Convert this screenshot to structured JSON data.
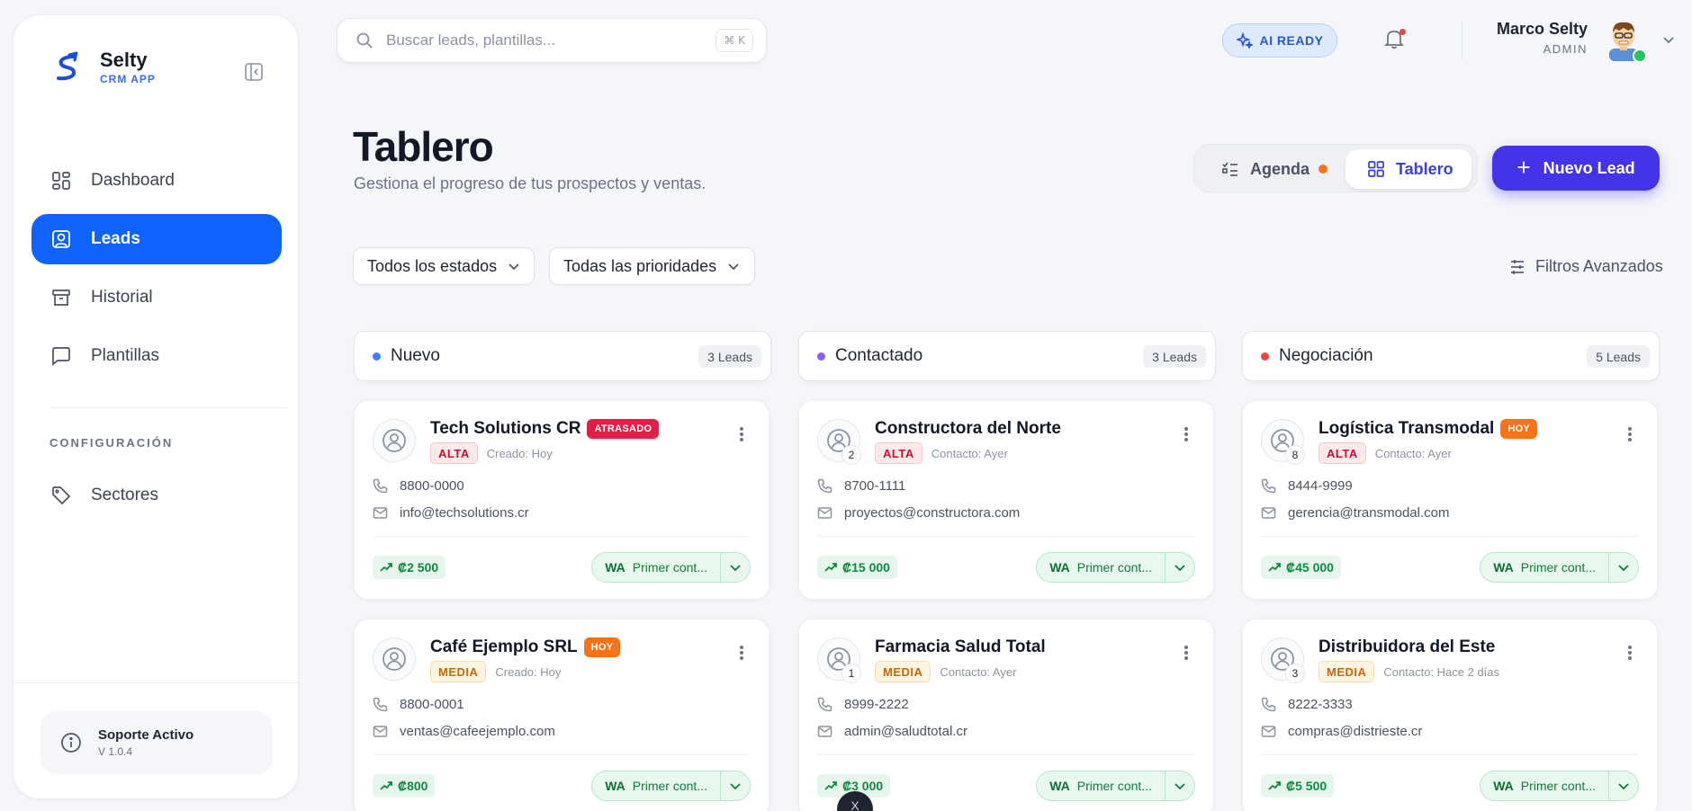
{
  "brand": {
    "name": "Selty",
    "sub": "CRM APP"
  },
  "nav": {
    "items": [
      {
        "label": "Dashboard",
        "icon": "grid-icon",
        "active": false
      },
      {
        "label": "Leads",
        "icon": "contact-icon",
        "active": true
      },
      {
        "label": "Historial",
        "icon": "archive-icon",
        "active": false
      },
      {
        "label": "Plantillas",
        "icon": "message-icon",
        "active": false
      }
    ],
    "section_title": "CONFIGURACIÓN",
    "config_items": [
      {
        "label": "Sectores",
        "icon": "tag-icon"
      }
    ]
  },
  "support": {
    "title": "Soporte Activo",
    "version": "V 1.0.4"
  },
  "search": {
    "placeholder": "Buscar leads, plantillas...",
    "shortcut": "⌘ K"
  },
  "ai_badge": "AI READY",
  "user": {
    "name": "Marco Selty",
    "role": "ADMIN"
  },
  "page": {
    "title": "Tablero",
    "subtitle": "Gestiona el progreso de tus prospectos y ventas."
  },
  "view_toggle": {
    "agenda": "Agenda",
    "tablero": "Tablero"
  },
  "new_lead_label": "Nuevo Lead",
  "filters": {
    "status": "Todos los estados",
    "priority": "Todas las prioridades",
    "advanced": "Filtros Avanzados"
  },
  "colors": {
    "primary": "#0f62fe",
    "accent": "#4433e8",
    "nuevo": "#3b82f6",
    "contactado": "#8b5cf6",
    "negociacion": "#ef4444"
  },
  "columns": [
    {
      "name": "Nuevo",
      "count": "3 Leads",
      "cards": [
        {
          "name": "Tech Solutions CR",
          "tag": "ATRASADO",
          "tag_type": "late",
          "badge": "",
          "priority": "ALTA",
          "when": "Creado: Hoy",
          "phone": "8800-0000",
          "email": "info@techsolutions.cr",
          "amount": "₡2 500",
          "action": "Primer cont..."
        },
        {
          "name": "Café Ejemplo SRL",
          "tag": "HOY",
          "tag_type": "today",
          "badge": "",
          "priority": "MEDIA",
          "when": "Creado: Hoy",
          "phone": "8800-0001",
          "email": "ventas@cafeejemplo.com",
          "amount": "₡800",
          "action": "Primer cont..."
        }
      ]
    },
    {
      "name": "Contactado",
      "count": "3 Leads",
      "cards": [
        {
          "name": "Constructora del Norte",
          "tag": "",
          "tag_type": "",
          "badge": "2",
          "priority": "ALTA",
          "when": "Contacto: Ayer",
          "phone": "8700-1111",
          "email": "proyectos@constructora.com",
          "amount": "₡15 000",
          "action": "Primer cont..."
        },
        {
          "name": "Farmacia Salud Total",
          "tag": "",
          "tag_type": "",
          "badge": "1",
          "priority": "MEDIA",
          "when": "Contacto: Ayer",
          "phone": "8999-2222",
          "email": "admin@saludtotal.cr",
          "amount": "₡3 000",
          "action": "Primer cont..."
        }
      ]
    },
    {
      "name": "Negociación",
      "count": "5 Leads",
      "cards": [
        {
          "name": "Logística Transmodal",
          "tag": "HOY",
          "tag_type": "today",
          "badge": "8",
          "priority": "ALTA",
          "when": "Contacto: Ayer",
          "phone": "8444-9999",
          "email": "gerencia@transmodal.com",
          "amount": "₡45 000",
          "action": "Primer cont..."
        },
        {
          "name": "Distribuidora del Este",
          "tag": "",
          "tag_type": "",
          "badge": "3",
          "priority": "MEDIA",
          "when": "Contacto: Hace 2 días",
          "phone": "8222-3333",
          "email": "compras@distrieste.cr",
          "amount": "₡5 500",
          "action": "Primer cont..."
        }
      ]
    }
  ],
  "wa_label": "WA",
  "fab_label": "X"
}
